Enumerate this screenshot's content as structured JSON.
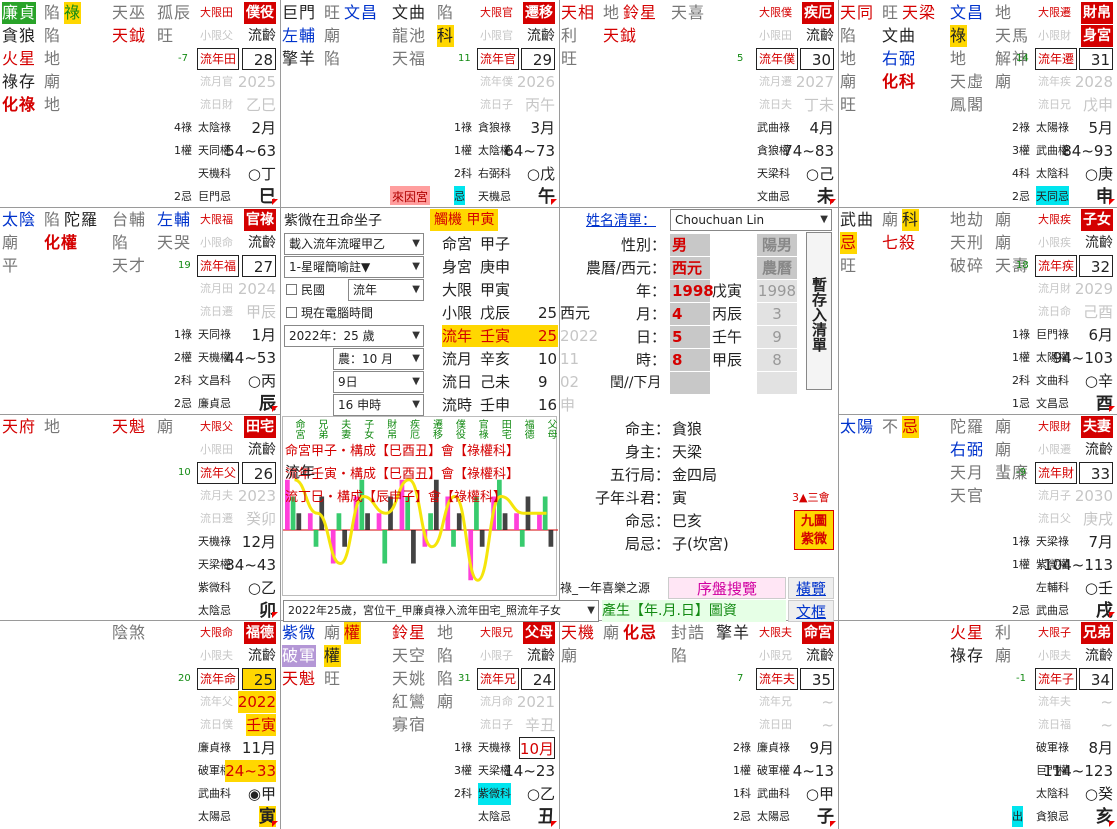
{
  "palaces": {
    "p0": {
      "stars": [
        {
          "t": "廉貞",
          "cls": "grn"
        },
        {
          "t": "陷",
          "cls": "gray"
        },
        {
          "t": "祿",
          "cls": "yel green"
        },
        {
          "t": "貪狼",
          "cls": ""
        },
        {
          "t": "陷",
          "cls": "gray"
        },
        {
          "t": "火星",
          "cls": "red"
        },
        {
          "t": "地",
          "cls": "gray"
        },
        {
          "t": "祿存",
          "cls": ""
        },
        {
          "t": "廟",
          "cls": "gray"
        },
        {
          "t": "化祿",
          "cls": "red big"
        },
        {
          "t": "地",
          "cls": "gray"
        }
      ],
      "minor": [
        {
          "t": "天巫",
          "cls": "gray"
        },
        {
          "t": "孤辰",
          "cls": "gray"
        },
        {
          "t": "天鉞",
          "cls": "red"
        },
        {
          "t": "旺",
          "cls": "gray"
        }
      ],
      "num": "-7",
      "lim": [
        "大限田",
        "小限父",
        "流年田",
        "流月官",
        "流日財"
      ],
      "name": "僕役",
      "lingling": "流齡",
      "age": "28",
      "year": "2025",
      "gz": "乙巳",
      "hua": [
        {
          "k": "4祿",
          "v": "太陰祿",
          "m": "2月"
        },
        {
          "k": "1權",
          "v": "天同權",
          "m": "54~63"
        },
        {
          "k": "",
          "v": "天機科",
          "m": "○丁"
        },
        {
          "k": "2忌",
          "v": "巨門忌",
          "m": "巳"
        }
      ]
    },
    "p1": {
      "stars": [
        {
          "t": "巨門",
          "cls": ""
        },
        {
          "t": "旺",
          "cls": "gray"
        },
        {
          "t": "文昌",
          "cls": "blue"
        },
        {
          "t": "左輔",
          "cls": "blue"
        },
        {
          "t": "廟",
          "cls": "gray"
        },
        {
          "t": "擎羊",
          "cls": ""
        },
        {
          "t": "陷",
          "cls": "gray"
        }
      ],
      "minor": [
        {
          "t": "文曲",
          "cls": ""
        },
        {
          "t": "陷",
          "cls": "gray"
        },
        {
          "t": "龍池",
          "cls": "gray"
        },
        {
          "t": "科",
          "cls": "yel"
        },
        {
          "t": "天福",
          "cls": "gray"
        }
      ],
      "num": "11",
      "lim": [
        "大限官",
        "小限官",
        "流年官",
        "流年僕",
        "流日子"
      ],
      "name": "遷移",
      "lingling": "流齡",
      "age": "29",
      "year": "2026",
      "gz": "丙午",
      "hua": [
        {
          "k": "1祿",
          "v": "貪狼祿",
          "m": "3月"
        },
        {
          "k": "1權",
          "v": "太陰權",
          "m": "64~73"
        },
        {
          "k": "2科",
          "v": "右弼科",
          "m": "○戊"
        },
        {
          "k": "忌",
          "v": "天機忌",
          "m": "午"
        }
      ],
      "tag": "來因宮"
    },
    "p2": {
      "stars": [
        {
          "t": "天相",
          "cls": "red"
        },
        {
          "t": "地",
          "cls": "gray"
        },
        {
          "t": "鈴星",
          "cls": "red"
        },
        {
          "t": "利",
          "cls": "gray"
        },
        {
          "t": "天鉞",
          "cls": "red"
        },
        {
          "t": "旺",
          "cls": "gray"
        }
      ],
      "minor": [
        {
          "t": "天喜",
          "cls": "gray"
        }
      ],
      "num": "5",
      "lim": [
        "大限僕",
        "小限田",
        "流年僕",
        "流月遷",
        "流日夫"
      ],
      "name": "疾厄",
      "lingling": "流齡",
      "age": "30",
      "year": "2027",
      "gz": "丁未",
      "hua": [
        {
          "k": "",
          "v": "武曲祿",
          "m": "4月"
        },
        {
          "k": "",
          "v": "貪狼權",
          "m": "74~83"
        },
        {
          "k": "",
          "v": "天梁科",
          "m": "○己"
        },
        {
          "k": "",
          "v": "文曲忌",
          "m": "未"
        }
      ]
    },
    "p3": {
      "stars": [
        {
          "t": "天同",
          "cls": "red"
        },
        {
          "t": "旺",
          "cls": "gray"
        },
        {
          "t": "天梁",
          "cls": "red"
        },
        {
          "t": "陷",
          "cls": "gray"
        },
        {
          "t": "文曲",
          "cls": ""
        },
        {
          "t": "地",
          "cls": "gray"
        },
        {
          "t": "右弼",
          "cls": "blue"
        },
        {
          "t": "廟",
          "cls": "gray"
        },
        {
          "t": "化科",
          "cls": "red big"
        },
        {
          "t": "旺",
          "cls": "gray"
        }
      ],
      "minor": [
        {
          "t": "文昌",
          "cls": "blue"
        },
        {
          "t": "地",
          "cls": "gray"
        },
        {
          "t": "祿",
          "cls": "yel"
        },
        {
          "t": "天馬",
          "cls": "gray"
        },
        {
          "t": "地",
          "cls": "gray"
        },
        {
          "t": "解神",
          "cls": "gray"
        },
        {
          "t": "天虛",
          "cls": "gray"
        },
        {
          "t": "廟",
          "cls": "gray"
        },
        {
          "t": "鳳閣",
          "cls": "gray"
        }
      ],
      "num": "14",
      "lim": [
        "大限遷",
        "小限財",
        "流年遷",
        "流年疾",
        "流日兄"
      ],
      "name": "財帛",
      "sub": "身宮",
      "age": "31",
      "year": "2028",
      "gz": "戊申",
      "hua": [
        {
          "k": "2祿",
          "v": "太陽祿",
          "m": "5月"
        },
        {
          "k": "3權",
          "v": "武曲權",
          "m": "84~93"
        },
        {
          "k": "4科",
          "v": "太陰科",
          "m": "○庚"
        },
        {
          "k": "2忌",
          "v": "天同忌",
          "m": "申"
        }
      ]
    },
    "p4": {
      "stars": [
        {
          "t": "太陰",
          "cls": "blue"
        },
        {
          "t": "陷",
          "cls": "gray"
        },
        {
          "t": "陀羅",
          "cls": ""
        },
        {
          "t": "廟",
          "cls": "gray"
        },
        {
          "t": "化權",
          "cls": "red big"
        },
        {
          "t": "平",
          "cls": "gray"
        }
      ],
      "minor": [
        {
          "t": "台輔",
          "cls": "gray"
        },
        {
          "t": "左輔",
          "cls": "blue"
        },
        {
          "t": "陷",
          "cls": "gray"
        },
        {
          "t": "天哭",
          "cls": "gray"
        },
        {
          "t": "天才",
          "cls": "gray"
        }
      ],
      "num": "19",
      "lim": [
        "大限福",
        "小限命",
        "流年福",
        "流月田",
        "流日遷"
      ],
      "name": "官祿",
      "lingling": "流齡",
      "age": "27",
      "year": "2024",
      "gz": "甲辰",
      "hua": [
        {
          "k": "1祿",
          "v": "天同祿",
          "m": "1月"
        },
        {
          "k": "2權",
          "v": "天機權",
          "m": "44~53"
        },
        {
          "k": "2科",
          "v": "文昌科",
          "m": "○丙"
        },
        {
          "k": "2忌",
          "v": "廉貞忌",
          "m": "辰"
        }
      ]
    },
    "p5": {
      "stars": [
        {
          "t": "武曲",
          "cls": ""
        },
        {
          "t": "廟",
          "cls": "gray"
        },
        {
          "t": "科",
          "cls": "yel"
        },
        {
          "t": "忌",
          "cls": "yel red"
        },
        {
          "t": "七殺",
          "cls": "red"
        },
        {
          "t": "旺",
          "cls": "gray"
        }
      ],
      "minor": [
        {
          "t": "地劫",
          "cls": "gray"
        },
        {
          "t": "廟",
          "cls": "gray"
        },
        {
          "t": "天刑",
          "cls": "gray"
        },
        {
          "t": "廟",
          "cls": "gray"
        },
        {
          "t": "破碎",
          "cls": "gray"
        },
        {
          "t": "天壽",
          "cls": "gray"
        }
      ],
      "num": "18",
      "lim": [
        "大限疾",
        "小限疾",
        "流年疾",
        "流月財",
        "流日命"
      ],
      "name": "子女",
      "lingling": "流齡",
      "age": "32",
      "year": "2029",
      "gz": "己酉",
      "hua": [
        {
          "k": "1祿",
          "v": "巨門祿",
          "m": "6月"
        },
        {
          "k": "1權",
          "v": "太陽權",
          "m": "94~103"
        },
        {
          "k": "2科",
          "v": "文曲科",
          "m": "○辛"
        },
        {
          "k": "1忌",
          "v": "文昌忌",
          "m": "酉"
        }
      ]
    },
    "p6": {
      "stars": [
        {
          "t": "天府",
          "cls": "red"
        },
        {
          "t": "地",
          "cls": "gray"
        }
      ],
      "minor": [
        {
          "t": "天魁",
          "cls": "red"
        },
        {
          "t": "廟",
          "cls": "gray"
        }
      ],
      "num": "10",
      "lim": [
        "大限父",
        "小限田",
        "流年父",
        "流月夫",
        "流日遷"
      ],
      "name": "田宅",
      "lingling": "流齡",
      "age": "26",
      "year": "2023",
      "gz": "癸卯",
      "hua": [
        {
          "k": "",
          "v": "天機祿",
          "m": "12月"
        },
        {
          "k": "",
          "v": "天梁權",
          "m": "34~43"
        },
        {
          "k": "",
          "v": "紫微科",
          "m": "○乙"
        },
        {
          "k": "",
          "v": "太陰忌",
          "m": "卯"
        }
      ]
    },
    "p7": {
      "stars": [
        {
          "t": "太陽",
          "cls": "blue"
        },
        {
          "t": "不",
          "cls": "gray"
        },
        {
          "t": "忌",
          "cls": "yel red"
        }
      ],
      "minor": [
        {
          "t": "陀羅",
          "cls": "gray"
        },
        {
          "t": "廟",
          "cls": "gray"
        },
        {
          "t": "右弼",
          "cls": "blue"
        },
        {
          "t": "廟",
          "cls": "gray"
        },
        {
          "t": "天月",
          "cls": "gray"
        },
        {
          "t": "蜚廉",
          "cls": "gray"
        },
        {
          "t": "天官",
          "cls": "gray"
        }
      ],
      "num": "-9",
      "lim": [
        "大限財",
        "小限遷",
        "流年財",
        "流月子",
        "流日父"
      ],
      "name": "夫妻",
      "lingling": "流齡",
      "age": "33",
      "year": "2030",
      "gz": "庚戌",
      "hua": [
        {
          "k": "1祿",
          "v": "天梁祿",
          "m": "7月"
        },
        {
          "k": "1權",
          "v": "紫微權",
          "m": "104~113"
        },
        {
          "k": "",
          "v": "左輔科",
          "m": "○壬"
        },
        {
          "k": "2忌",
          "v": "武曲忌",
          "m": "戌"
        }
      ]
    },
    "p8": {
      "stars": [],
      "minor": [
        {
          "t": "陰煞",
          "cls": "gray"
        }
      ],
      "num": "20",
      "lim": [
        "大限命",
        "小限夫",
        "流年命",
        "流年父",
        "流日僕"
      ],
      "name": "福德",
      "lingling": "流齡",
      "age": "25",
      "year": "2022",
      "gz": "壬寅",
      "hua": [
        {
          "k": "",
          "v": "廉貞祿",
          "m": "11月"
        },
        {
          "k": "",
          "v": "破軍權",
          "m": "24~33"
        },
        {
          "k": "",
          "v": "武曲科",
          "m": "◉甲"
        },
        {
          "k": "",
          "v": "太陽忌",
          "m": "寅"
        }
      ]
    },
    "p9": {
      "stars": [
        {
          "t": "紫微",
          "cls": "blue"
        },
        {
          "t": "廟",
          "cls": "gray"
        },
        {
          "t": "權",
          "cls": "yel red"
        },
        {
          "t": "破軍",
          "cls": "lav"
        },
        {
          "t": "權",
          "cls": "yel"
        },
        {
          "t": "天魁",
          "cls": "red"
        },
        {
          "t": "旺",
          "cls": "gray"
        }
      ],
      "minor": [
        {
          "t": "鈴星",
          "cls": "red"
        },
        {
          "t": "地",
          "cls": "gray"
        },
        {
          "t": "天空",
          "cls": "gray"
        },
        {
          "t": "陷",
          "cls": "gray"
        },
        {
          "t": "天姚",
          "cls": "gray"
        },
        {
          "t": "陷",
          "cls": "gray"
        },
        {
          "t": "紅鸞",
          "cls": "gray"
        },
        {
          "t": "廟",
          "cls": "gray"
        },
        {
          "t": "寡宿",
          "cls": "gray"
        }
      ],
      "num": "31",
      "lim": [
        "大限兄",
        "小限子",
        "流年兄",
        "流月命",
        "流日子"
      ],
      "name": "父母",
      "lingling": "流齡",
      "age": "24",
      "year": "2021",
      "gz": "辛丑",
      "hua": [
        {
          "k": "1祿",
          "v": "天機祿",
          "m": "10月"
        },
        {
          "k": "3權",
          "v": "天梁權",
          "m": "14~23"
        },
        {
          "k": "2科",
          "v": "紫微科",
          "m": "○乙"
        },
        {
          "k": "",
          "v": "太陰忌",
          "m": "丑"
        }
      ]
    },
    "p10": {
      "stars": [
        {
          "t": "天機",
          "cls": "red"
        },
        {
          "t": "廟",
          "cls": "gray"
        },
        {
          "t": "化忌",
          "cls": "red big"
        },
        {
          "t": "廟",
          "cls": "gray"
        }
      ],
      "minor": [
        {
          "t": "封誥",
          "cls": "gray"
        },
        {
          "t": "擎羊",
          "cls": ""
        },
        {
          "t": "陷",
          "cls": "gray"
        }
      ],
      "num": "7",
      "lim": [
        "大限夫",
        "小限兄",
        "流年夫",
        "流年兄",
        "流日田"
      ],
      "name": "命宮",
      "lingling": "流齡",
      "age": "35",
      "year": "~",
      "gz": "~",
      "hua": [
        {
          "k": "2祿",
          "v": "廉貞祿",
          "m": "9月"
        },
        {
          "k": "1權",
          "v": "破軍權",
          "m": "4~13"
        },
        {
          "k": "1科",
          "v": "武曲科",
          "m": "○甲"
        },
        {
          "k": "2忌",
          "v": "太陽忌",
          "m": "子"
        }
      ]
    },
    "p11": {
      "stars": [],
      "minor": [
        {
          "t": "火星",
          "cls": "red"
        },
        {
          "t": "利",
          "cls": "gray"
        },
        {
          "t": "祿存",
          "cls": ""
        },
        {
          "t": "廟",
          "cls": "gray"
        }
      ],
      "num": "-1",
      "lim": [
        "大限子",
        "小限夫",
        "流年子",
        "流年夫",
        "流日福"
      ],
      "name": "兄弟",
      "lingling": "流齡",
      "age": "34",
      "year": "~",
      "gz": "~",
      "hua": [
        {
          "k": "",
          "v": "破軍祿",
          "m": "8月"
        },
        {
          "k": "",
          "v": "巨門權",
          "m": "114~123"
        },
        {
          "k": "",
          "v": "太陰科",
          "m": "○癸"
        },
        {
          "k": "出",
          "v": "貪狼忌",
          "m": "亥"
        }
      ]
    }
  },
  "center": {
    "title": "紫微在丑命坐子",
    "badge": "觸機 甲寅",
    "name_list_label": "姓名清單：",
    "name_value": "Chouchuan Lin",
    "load_select": "載入流年流曜甲乙",
    "star_select": "1-星曜簡喻註▼",
    "minguo_label": "民國",
    "liunian_select": "流年",
    "computer_time_label": "現在電腦時間",
    "year_select": "2022年：25 歲",
    "month_select": "農：10 月",
    "day_select": "9日",
    "hour_select": "16 申時",
    "gender_label": "性別：",
    "gender_value": "男",
    "yin_yang": "陽男",
    "calendar_label": "農曆/西元：",
    "calendar_value": "西元",
    "calendar_alt": "農曆",
    "year_label": "年：",
    "year_value": "1998",
    "year_gz": "戊寅",
    "year_lunar": "1998",
    "month_label": "月：",
    "month_value": "4",
    "month_gz": "丙辰",
    "month_lunar": "3",
    "day_label": "日：",
    "day_value": "5",
    "day_gz": "壬午",
    "day_lunar": "9",
    "hour_label": "時：",
    "hour_value": "8",
    "hour_gz": "甲辰",
    "hour_lunar": "8",
    "leap_label": "閏//下月",
    "save_button": "暫存入清單",
    "rows": [
      {
        "label": "命宮",
        "v": "甲子",
        "n": "",
        "x": ""
      },
      {
        "label": "身宮",
        "v": "庚申",
        "n": "",
        "x": ""
      },
      {
        "label": "大限",
        "v": "甲寅",
        "n": "",
        "x": ""
      },
      {
        "label": "小限",
        "v": "戊辰",
        "n": "25",
        "x": "西元"
      },
      {
        "label": "流年",
        "v": "壬寅",
        "n": "25",
        "x": "2022"
      },
      {
        "label": "流月",
        "v": "辛亥",
        "n": "10",
        "x": "11"
      },
      {
        "label": "流日",
        "v": "己未",
        "n": "9",
        "x": "02"
      },
      {
        "label": "流時",
        "v": "壬申",
        "n": "16",
        "x": "申"
      }
    ],
    "ming_zhu_label": "命主：",
    "ming_zhu": "貪狼",
    "shen_zhu_label": "身主：",
    "shen_zhu": "天梁",
    "wuxing_label": "五行局：",
    "wuxing": "金四局",
    "doujun_label": "子年斗君：",
    "doujun": "寅",
    "mingji_label": "命忌：",
    "mingji": "巳亥",
    "juji_label": "局忌：",
    "juji": "子(坎宮)",
    "three_hui": "3▲三會",
    "jiugong_button": "九圖紫微",
    "source_text": "祿_一年喜樂之源",
    "search_button": "序盤搜覽",
    "browse_button": "橫覽",
    "generate_label": "產生【年.月.日】圖資",
    "text_button": "文框",
    "status_select": "2022年25歲，宮位干_甲廉貞祿入流年田宅_照流年子女"
  },
  "chart_data": {
    "type": "bar",
    "categories": [
      "命宮",
      "兄弟",
      "夫妻",
      "子女",
      "財帛",
      "疾厄",
      "遷移",
      "僕役",
      "官祿",
      "田宅",
      "福德",
      "父母"
    ],
    "overlay_lines": [
      "命宮甲子・構成【巳酉丑】會【祿權科】",
      "流年壬寅・構成【巳酉丑】會【祿權科】",
      "流丁巳・構成【辰申子】會【祿權科】"
    ],
    "overlay_label": "流年",
    "series": [
      {
        "values": [
          3,
          1,
          -2,
          2,
          1,
          3,
          -1,
          2,
          -3,
          2,
          1,
          1
        ]
      },
      {
        "values": [
          2,
          -1,
          1,
          3,
          -2,
          2,
          1,
          -1,
          2,
          3,
          -1,
          2
        ]
      },
      {
        "values": [
          1,
          2,
          -1,
          1,
          2,
          -2,
          3,
          1,
          -1,
          1,
          2,
          -1
        ]
      }
    ],
    "ylim": [
      -4,
      4
    ]
  }
}
